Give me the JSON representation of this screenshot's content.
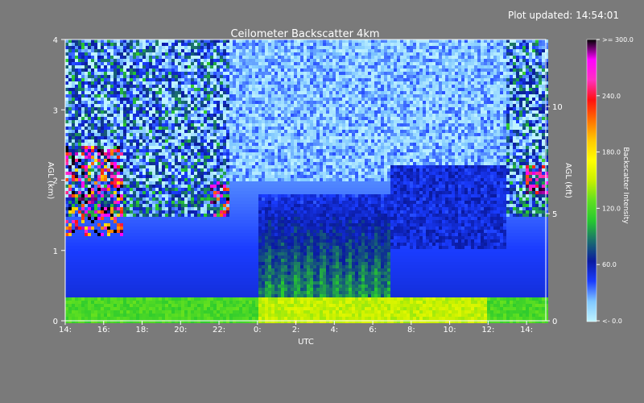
{
  "updated": "Plot updated: 14:54:01",
  "chart_data": {
    "type": "heatmap",
    "title": "Ceilometer Backscatter 4km",
    "xlabel": "UTC",
    "ylabel_left": "AGL (km)",
    "ylabel_right": "AGL (kft)",
    "colorbar_label": "Backscatter Intensity",
    "x_ticks": [
      "14:",
      "16:",
      "18:",
      "20:",
      "22:",
      "0:",
      "2:",
      "4:",
      "6:",
      "8:",
      "10:",
      "12:",
      "14:"
    ],
    "x_tick_hours": [
      14,
      16,
      18,
      20,
      22,
      24,
      26,
      28,
      30,
      32,
      34,
      36,
      38
    ],
    "xlim_hours": [
      14,
      39
    ],
    "y_ticks_km": [
      0,
      1,
      2,
      3,
      4
    ],
    "ylim_km": [
      0,
      4
    ],
    "y_ticks_kft": [
      0,
      5,
      10
    ],
    "colorbar_ticks": [
      "<-   0.0",
      "60.0",
      "120.0",
      "180.0",
      "240.0",
      ">= 300.0"
    ],
    "colorbar_tick_values": [
      0,
      60,
      120,
      180,
      240,
      300
    ],
    "colorbar_range": [
      0,
      300
    ],
    "colormap": [
      "#bff3ff",
      "#80c8ff",
      "#1a3cff",
      "#0a1aa0",
      "#1a6e6e",
      "#26c830",
      "#60e020",
      "#c8f000",
      "#ffff00",
      "#ffc800",
      "#ff7000",
      "#ff1010",
      "#ff30c0",
      "#ff00ff",
      "#000000"
    ],
    "features": [
      {
        "name": "surface aerosol layer",
        "height_km": [
          0,
          0.3
        ],
        "intensity": 130
      },
      {
        "name": "mixed layer plumes",
        "hours": [
          24,
          31
        ],
        "height_km": [
          0.2,
          1.8
        ],
        "intensity": 85
      },
      {
        "name": "cloud returns",
        "hours": [
          14,
          17
        ],
        "height_km": [
          1.2,
          2.5
        ],
        "intensity": 300
      }
    ]
  }
}
